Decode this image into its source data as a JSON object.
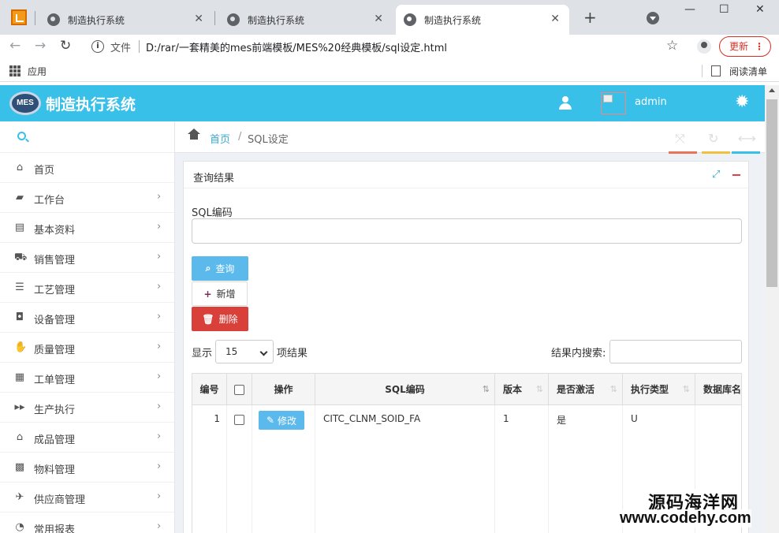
{
  "browser": {
    "tabs": [
      {
        "title": "制造执行系统",
        "close": "✕",
        "active": false
      },
      {
        "title": "制造执行系统",
        "close": "✕",
        "active": false
      },
      {
        "title": "制造执行系统",
        "close": "✕",
        "active": true
      }
    ],
    "new_tab": "+",
    "window_controls": {
      "minimize": "—",
      "maximize": "☐",
      "close": "✕"
    },
    "nav": {
      "back": "←",
      "forward": "→",
      "reload": "↻"
    },
    "address": {
      "scheme_label": "文件",
      "url": "D:/rar/一套精美的mes前端模板/MES%20经典模板/sql设定.html",
      "info_glyph": "i"
    },
    "bookmark_star": "☆",
    "update_button": {
      "label": "更新",
      "menu": "⋮"
    },
    "bookmarks_bar": {
      "apps_label": "应用",
      "reading_list_label": "阅读清单"
    }
  },
  "app": {
    "logo_text": "MES",
    "title": "制造执行系统",
    "user_name": "admin",
    "gear_glyph": "✹"
  },
  "sidebar": {
    "items": [
      {
        "label": "首页",
        "icon": "home-icon",
        "glyph": "⌂",
        "chevron": ""
      },
      {
        "label": "工作台",
        "icon": "comment-icon",
        "glyph": "▰",
        "chevron": "›"
      },
      {
        "label": "基本资料",
        "icon": "document-icon",
        "glyph": "▤",
        "chevron": "›"
      },
      {
        "label": "销售管理",
        "icon": "cart-icon",
        "glyph": "⛟",
        "chevron": "›"
      },
      {
        "label": "工艺管理",
        "icon": "list-icon",
        "glyph": "☰",
        "chevron": "›"
      },
      {
        "label": "设备管理",
        "icon": "inbox-icon",
        "glyph": "◘",
        "chevron": "›"
      },
      {
        "label": "质量管理",
        "icon": "thumbs-up-icon",
        "glyph": "✋",
        "chevron": "›"
      },
      {
        "label": "工单管理",
        "icon": "table-icon",
        "glyph": "▦",
        "chevron": "›"
      },
      {
        "label": "生产执行",
        "icon": "forward-icon",
        "glyph": "▸▸",
        "chevron": "›"
      },
      {
        "label": "成品管理",
        "icon": "home-icon",
        "glyph": "⌂",
        "chevron": "›"
      },
      {
        "label": "物料管理",
        "icon": "grid-icon",
        "glyph": "▩",
        "chevron": "›"
      },
      {
        "label": "供应商管理",
        "icon": "plane-icon",
        "glyph": "✈",
        "chevron": "›"
      },
      {
        "label": "常用报表",
        "icon": "report-icon",
        "glyph": "◔",
        "chevron": "›"
      }
    ]
  },
  "breadcrumb": {
    "home": "首页",
    "separator": "/",
    "current": "SQL设定"
  },
  "toolbar": {
    "fullscreen_glyph": "⤧",
    "refresh_glyph": "↻",
    "collapse_glyph": "⟷",
    "colors": {
      "fullscreen": "#e8745a",
      "refresh": "#f0c040",
      "collapse": "#39c0e8"
    }
  },
  "panel": {
    "title": "查询结果",
    "expand_glyph": "⤢",
    "field_label": "SQL编码",
    "field_value": "",
    "buttons": {
      "query": {
        "label": "查询",
        "glyph": "⌕"
      },
      "add": {
        "label": "新增",
        "glyph": "+"
      },
      "delete": {
        "label": "删除",
        "glyph": "🗑"
      }
    },
    "length": {
      "prefix": "显示",
      "value": "15",
      "suffix": "项结果"
    },
    "filter": {
      "label": "结果内搜索:",
      "value": ""
    }
  },
  "table": {
    "headers": {
      "id": "编号",
      "op": "操作",
      "sql_code": "SQL编码",
      "version": "版本",
      "active": "是否激活",
      "exec_type": "执行类型",
      "db_name": "数据库名"
    },
    "sort_glyph": "⇅",
    "rows": [
      {
        "id": "1",
        "edit_label": "修改",
        "edit_glyph": "✎",
        "sql_code": "CITC_CLNM_SOID_FA",
        "version": "1",
        "active": "是",
        "exec_type": "U",
        "db_name": ""
      }
    ]
  },
  "watermark": {
    "line1": "源码海洋网",
    "line2": "www.codehy.com"
  }
}
